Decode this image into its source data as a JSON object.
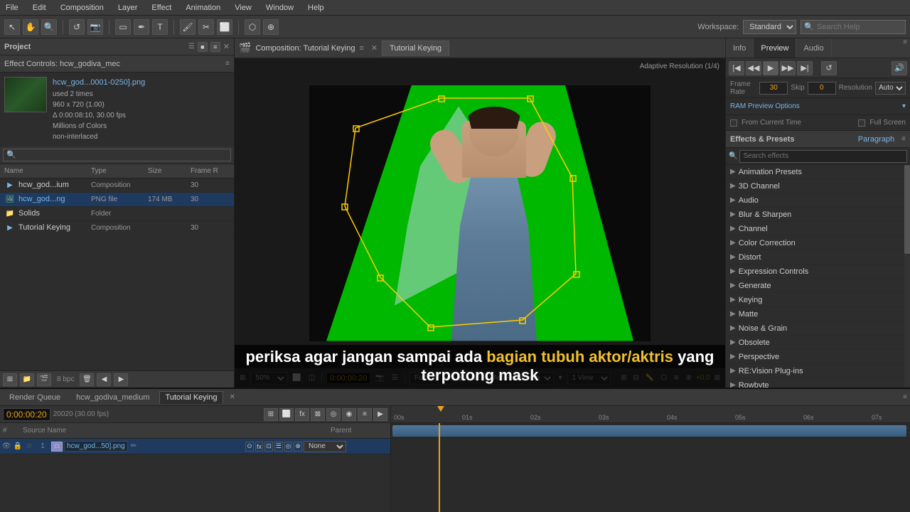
{
  "menu": {
    "items": [
      "File",
      "Edit",
      "Composition",
      "Layer",
      "Effect",
      "Animation",
      "View",
      "Window",
      "Help"
    ]
  },
  "toolbar": {
    "workspace_label": "Workspace:",
    "workspace_value": "Standard",
    "search_placeholder": "Search Help"
  },
  "project_panel": {
    "title": "Project",
    "effect_controls_title": "Effect Controls: hcw_godiva_mec",
    "file": {
      "name": "hcw_god...0001-0250].png",
      "used": "used 2 times",
      "resolution": "960 x 720 (1.00)",
      "timecode": "Δ 0:00:08:10, 30.00 fps",
      "colors": "Millions of Colors",
      "interlace": "non-interlaced"
    },
    "search_placeholder": "🔍",
    "columns": {
      "name": "Name",
      "type": "Type",
      "size": "Size",
      "frame": "Frame R"
    },
    "files": [
      {
        "name": "hcw_god...ium",
        "type": "Composition",
        "size": "",
        "frame": "30",
        "icon": "comp",
        "indent": 0
      },
      {
        "name": "hcw_god...ng",
        "type": "PNG file",
        "size": "174 MB",
        "frame": "30",
        "icon": "png",
        "indent": 0,
        "selected": true
      },
      {
        "name": "Solids",
        "type": "Folder",
        "size": "",
        "frame": "",
        "icon": "folder",
        "indent": 0
      },
      {
        "name": "Tutorial Keying",
        "type": "Composition",
        "size": "",
        "frame": "30",
        "icon": "comp",
        "indent": 0
      }
    ]
  },
  "composition": {
    "title": "Composition: Tutorial Keying",
    "tab": "Tutorial Keying",
    "viewer_info": "Adaptive Resolution (1/4)",
    "timecode": "0:00:00:20",
    "zoom": "50%",
    "quality": "Full",
    "camera": "Active Camera",
    "view": "1 View",
    "offset": "+0.0"
  },
  "right_panel": {
    "tabs": [
      "Info",
      "Preview",
      "Audio"
    ],
    "playback_options": "RAM Preview Options",
    "frame_rate": {
      "label": "Frame Rate",
      "value": "30",
      "skip_label": "Skip",
      "skip_value": "0",
      "resolution_label": "Resolution",
      "resolution_value": "Auto"
    },
    "options": {
      "from_current": "From Current Time",
      "full_screen": "Full Screen"
    },
    "effects_title": "Effects & Presets",
    "paragraph": "Paragraph",
    "categories": [
      {
        "name": "Animation Presets",
        "expanded": true
      },
      {
        "name": "3D Channel",
        "expanded": false
      },
      {
        "name": "Audio",
        "expanded": false
      },
      {
        "name": "Blur & Sharpen",
        "expanded": false
      },
      {
        "name": "Channel",
        "expanded": false
      },
      {
        "name": "Color Correction",
        "expanded": false
      },
      {
        "name": "Distort",
        "expanded": false
      },
      {
        "name": "Expression Controls",
        "expanded": false
      },
      {
        "name": "Generate",
        "expanded": false
      },
      {
        "name": "Keying",
        "expanded": false
      },
      {
        "name": "Matte",
        "expanded": false
      },
      {
        "name": "Noise & Grain",
        "expanded": false
      },
      {
        "name": "Obsolete",
        "expanded": false
      },
      {
        "name": "Perspective",
        "expanded": false
      },
      {
        "name": "RE:Vision Plug-ins",
        "expanded": false
      },
      {
        "name": "Rowbyte",
        "expanded": false
      }
    ]
  },
  "timeline": {
    "tabs": [
      "Render Queue",
      "hcw_godiva_medium",
      "Tutorial Keying"
    ],
    "active_tab": "Tutorial Keying",
    "timecode": "0:00:00:20",
    "fps": "20020 (30.00 fps)",
    "columns": {
      "source": "Source Name",
      "parent": "Parent"
    },
    "layers": [
      {
        "num": "1",
        "name": "hcw_god...50].png",
        "parent": "None",
        "selected": true
      }
    ],
    "time_marks": [
      "00s",
      "01s",
      "02s",
      "03s",
      "04s",
      "05s",
      "06s",
      "07s"
    ]
  },
  "subtitle": {
    "text": "periksa agar jangan sampai ada bagian tubuh aktor/aktris yang terpotong mask",
    "highlight_words": [
      "bagian tubuh aktor/aktris"
    ]
  }
}
